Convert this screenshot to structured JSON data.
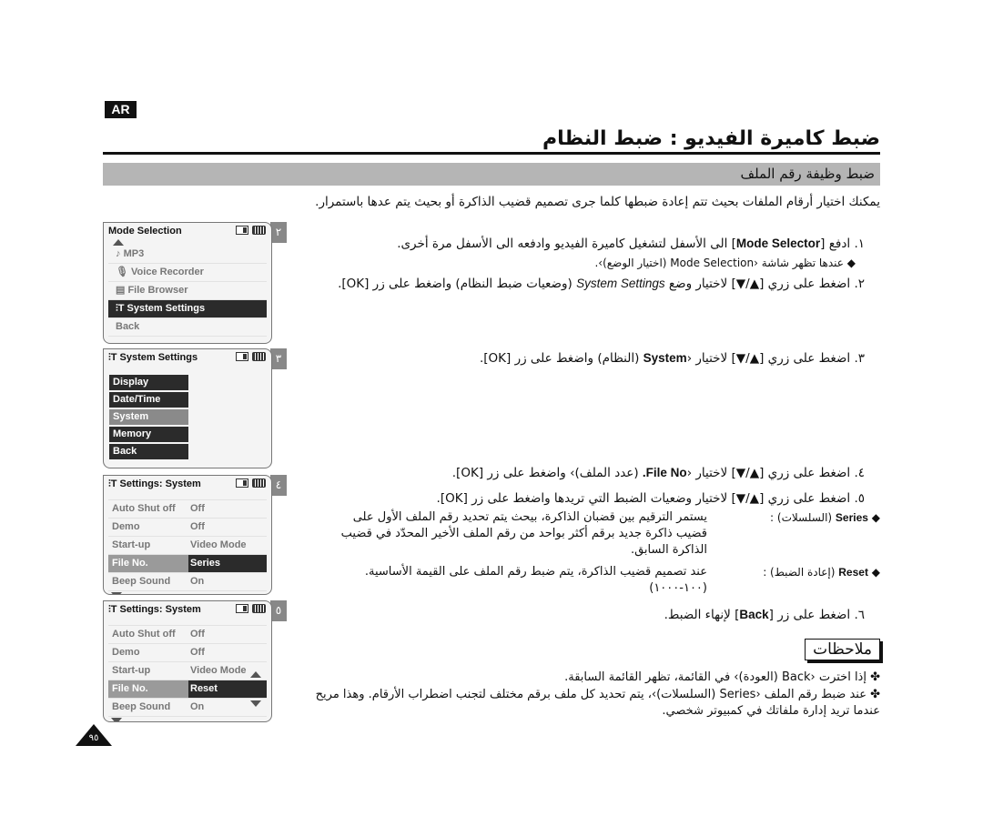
{
  "badge": "AR",
  "title": "ضبط كاميرة الفيديو : ضبط النظام",
  "section": "ضبط وظيفة رقم الملف",
  "intro": "يمكنك اختيار أرقام الملفات بحيث تتم إعادة ضبطها كلما جرى تصميم قضيب الذاكرة أو بحيث يتم عدها باستمرار.",
  "steps": [
    {
      "num": "١.",
      "pre": "ادفع [",
      "key": "Mode Selector",
      "post": "] الى الأسفل لتشغيل كاميرة الفيديو وادفعه الى الأسفل مرة أخرى."
    },
    {
      "num": "٢.",
      "pre": "اضغط على زري [▲/▼] لاختيار وضع",
      "key": "System Settings",
      "post": "(وضعيات ضبط النظام) واضغط على زر [OK]."
    },
    {
      "num": "٣.",
      "pre": "اضغط على زري [▲/▼] لاختيار ‹",
      "key": "System",
      "post": "(النظام) واضغط على زر [OK]."
    },
    {
      "num": "٤.",
      "pre": "اضغط على زري [▲/▼] لاختيار ‹",
      "key": "File No.",
      "post": "(عدد الملف)› واضغط على زر [OK]."
    },
    {
      "num": "٥.",
      "text": "اضغط على زري [▲/▼] لاختيار وضعيات الضبط التي تريدها واضغط على زر [OK]."
    },
    {
      "num": "٦.",
      "pre": "اضغط على زر [",
      "key": "Back",
      "post": "] لإنهاء الضبط."
    }
  ],
  "step1_bullet": "عندها تظهر شاشة ‹Mode Selection (اختيار الوضع)›.",
  "series_bullet": {
    "key": "Series",
    "label": "(السلسلات) :",
    "text": "يستمر الترقيم بين قضبان الذاكرة، بيحث يتم تحديد رقم الملف الأول على قضيب ذاكرة جديد برقم أكثر بواحد من رقم الملف الأخير المحدّد في قضيب الذاكرة السابق."
  },
  "reset_bullet": {
    "key": "Reset",
    "label": "(إعادة الضبط) :",
    "text": "عند تصميم قضيب الذاكرة، يتم ضبط رقم الملف على القيمة الأساسية. (١٠٠-١٠٠٠)"
  },
  "notes_title": "ملاحظات",
  "notes": [
    "إذا اخترت ‹Back (العودة)› في القائمة، تظهر القائمة السابقة.",
    "عند ضبط رقم الملف ‹Series (السلسلات)›، يتم تحديد كل ملف برقم مختلف لتجنب اضطراب الأرقام. وهذا مريح عندما تريد إدارة ملفاتك في كمبيوتر شخصي."
  ],
  "screens": {
    "s2": {
      "step": "٢",
      "title": "Mode Selection",
      "items": [
        "MP3",
        "Voice Recorder",
        "File Browser",
        "System Settings",
        "Back"
      ],
      "selected": "System Settings"
    },
    "s3": {
      "step": "٣",
      "title": "System Settings",
      "items": [
        "Display",
        "Date/Time",
        "System",
        "Memory",
        "Back"
      ],
      "selected": "System"
    },
    "s4": {
      "step": "٤",
      "title": "Settings: System",
      "rows": [
        [
          "Auto Shut off",
          "Off"
        ],
        [
          "Demo",
          "Off"
        ],
        [
          "Start-up",
          "Video Mode"
        ],
        [
          "File No.",
          "Series"
        ],
        [
          "Beep Sound",
          "On"
        ]
      ]
    },
    "s5": {
      "step": "٥",
      "title": "Settings: System",
      "rows": [
        [
          "Auto Shut off",
          "Off"
        ],
        [
          "Demo",
          "Off"
        ],
        [
          "Start-up",
          "Video Mode"
        ],
        [
          "File No.",
          "Reset"
        ],
        [
          "Beep Sound",
          "On"
        ]
      ]
    }
  },
  "page_number": "٩٥"
}
